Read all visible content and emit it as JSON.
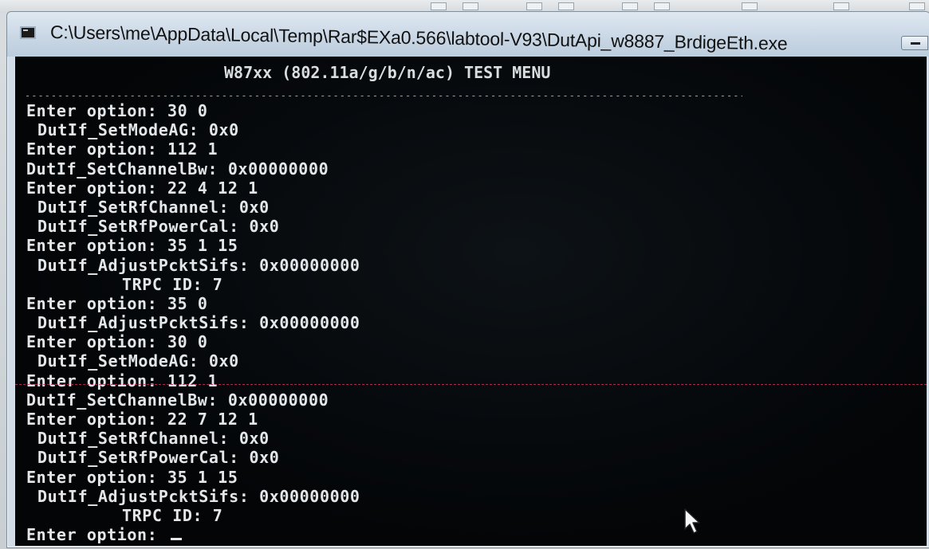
{
  "window": {
    "title": "C:\\Users\\me\\AppData\\Local\\Temp\\Rar$EXa0.566\\labtool-V93\\DutApi_w8887_BrdigeEth.exe"
  },
  "console": {
    "header": "W87xx (802.11a/g/b/n/ac) TEST MENU",
    "separator": "------------------------------------------------------------------------------------------------------------------------------------------",
    "lines": [
      {
        "text": "Enter option: 30 0",
        "style": ""
      },
      {
        "text": "DutIf_SetModeAG: 0x0",
        "style": "indent"
      },
      {
        "text": "Enter option: 112 1",
        "style": ""
      },
      {
        "text": "DutIf_SetChannelBw: 0x00000000",
        "style": ""
      },
      {
        "text": "Enter option: 22 4 12 1",
        "style": ""
      },
      {
        "text": "DutIf_SetRfChannel: 0x0",
        "style": "indent"
      },
      {
        "text": "DutIf_SetRfPowerCal: 0x0",
        "style": "indent"
      },
      {
        "text": "Enter option: 35 1 15",
        "style": ""
      },
      {
        "text": "DutIf_AdjustPcktSifs: 0x00000000",
        "style": "indent"
      },
      {
        "text": "TRPC ID: 7",
        "style": "deep"
      },
      {
        "text": "Enter option: 35 0",
        "style": ""
      },
      {
        "text": "DutIf_AdjustPcktSifs: 0x00000000",
        "style": "indent"
      },
      {
        "text": "Enter option: 30 0",
        "style": ""
      },
      {
        "text": "DutIf_SetModeAG: 0x0",
        "style": "indent"
      },
      {
        "text": "Enter option: 112 1",
        "style": ""
      },
      {
        "text": "DutIf_SetChannelBw: 0x00000000",
        "style": ""
      },
      {
        "text": "Enter option: 22 7 12 1",
        "style": ""
      },
      {
        "text": "DutIf_SetRfChannel: 0x0",
        "style": "indent"
      },
      {
        "text": "DutIf_SetRfPowerCal: 0x0",
        "style": "indent"
      },
      {
        "text": "Enter option: 35 1 15",
        "style": ""
      },
      {
        "text": "DutIf_AdjustPcktSifs: 0x00000000",
        "style": "indent"
      },
      {
        "text": "TRPC ID: 7",
        "style": "deep"
      }
    ],
    "prompt": "Enter option: "
  },
  "colors": {
    "console_bg": "#030507",
    "console_fg": "#e4e7e9",
    "scanline": "#c0305a"
  },
  "icons": {
    "window_icon": "console-app-icon",
    "minimize": "minimize-icon",
    "pointer": "mouse-pointer-icon"
  }
}
